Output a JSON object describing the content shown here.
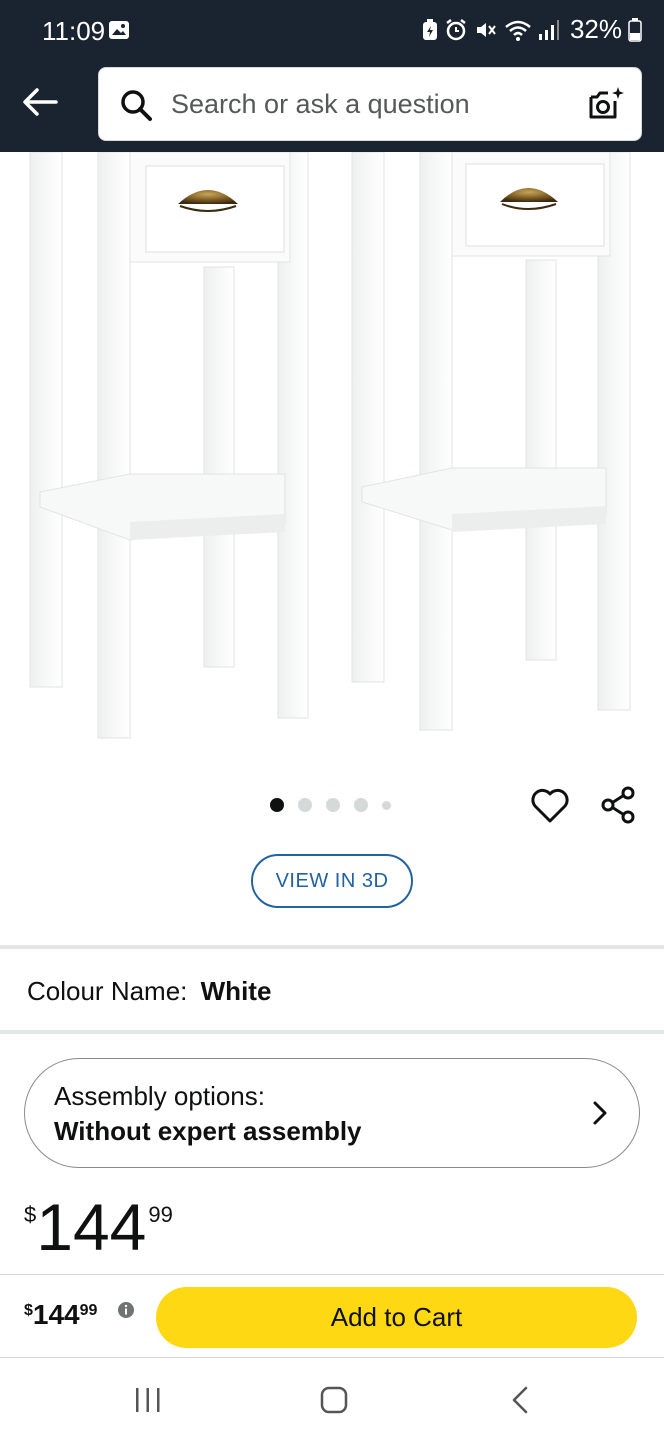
{
  "status_bar": {
    "time": "11:09",
    "battery": "32%",
    "icons": [
      "gallery-icon",
      "battery-saver-icon",
      "alarm-icon",
      "mute-icon",
      "wifi-icon",
      "signal-icon",
      "battery-icon"
    ]
  },
  "header": {
    "back_icon": "back-arrow-icon",
    "search_placeholder": "Search or ask a question",
    "search_icon": "search-icon",
    "camera_icon": "camera-search-icon",
    "background_color": "#1a2431"
  },
  "product_image": {
    "description_icon": "product-photo",
    "carousel_dots": 5,
    "active_dot": 0
  },
  "actions": {
    "wishlist_icon": "heart-icon",
    "share_icon": "share-icon",
    "view_3d_label": "VIEW IN 3D"
  },
  "colour": {
    "label": "Colour Name:",
    "value": "White"
  },
  "assembly": {
    "label": "Assembly options:",
    "value": "Without expert assembly",
    "icon": "chevron-right-icon"
  },
  "price": {
    "currency": "$",
    "whole": "144",
    "fraction": "99"
  },
  "buy_bar": {
    "currency": "$",
    "whole": "144",
    "fraction": "99",
    "info_icon": "info-icon",
    "add_to_cart_label": "Add to Cart",
    "button_color": "#ffd814"
  },
  "nav_bar": {
    "recent_icon": "recent-apps-icon",
    "home_icon": "home-icon",
    "back_icon": "back-chevron-icon"
  },
  "colors": {
    "link_blue": "#2162a1",
    "text": "#0f1111",
    "divider": "#e3e6e6"
  }
}
